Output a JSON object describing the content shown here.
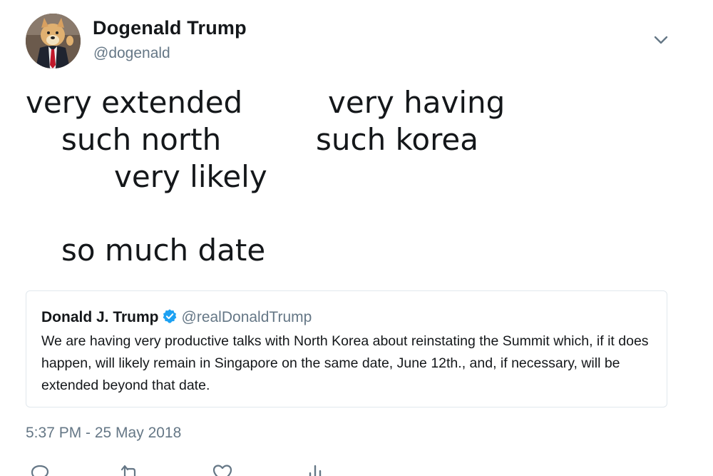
{
  "tweet": {
    "display_name": "Dogenald Trump",
    "handle": "@dogenald",
    "lines": [
      "very extended",
      "very having",
      "such north",
      "such korea",
      "very likely",
      "so much date"
    ],
    "timestamp": "5:37 PM - 25 May 2018"
  },
  "quote": {
    "name": "Donald J. Trump",
    "handle": "@realDonaldTrump",
    "verified": true,
    "text": "We are having very productive talks with North Korea about reinstating the Summit which, if it does happen, will likely remain in Singapore on the same date, June 12th., and, if necessary, will be extended beyond that date."
  },
  "icons": {
    "caret": "chevron-down-icon",
    "actions": [
      "reply-icon",
      "retweet-icon",
      "like-icon",
      "analytics-icon"
    ]
  },
  "colors": {
    "text": "#14171a",
    "secondary": "#657786",
    "verified": "#1da1f2",
    "border": "#e1e8ed"
  }
}
